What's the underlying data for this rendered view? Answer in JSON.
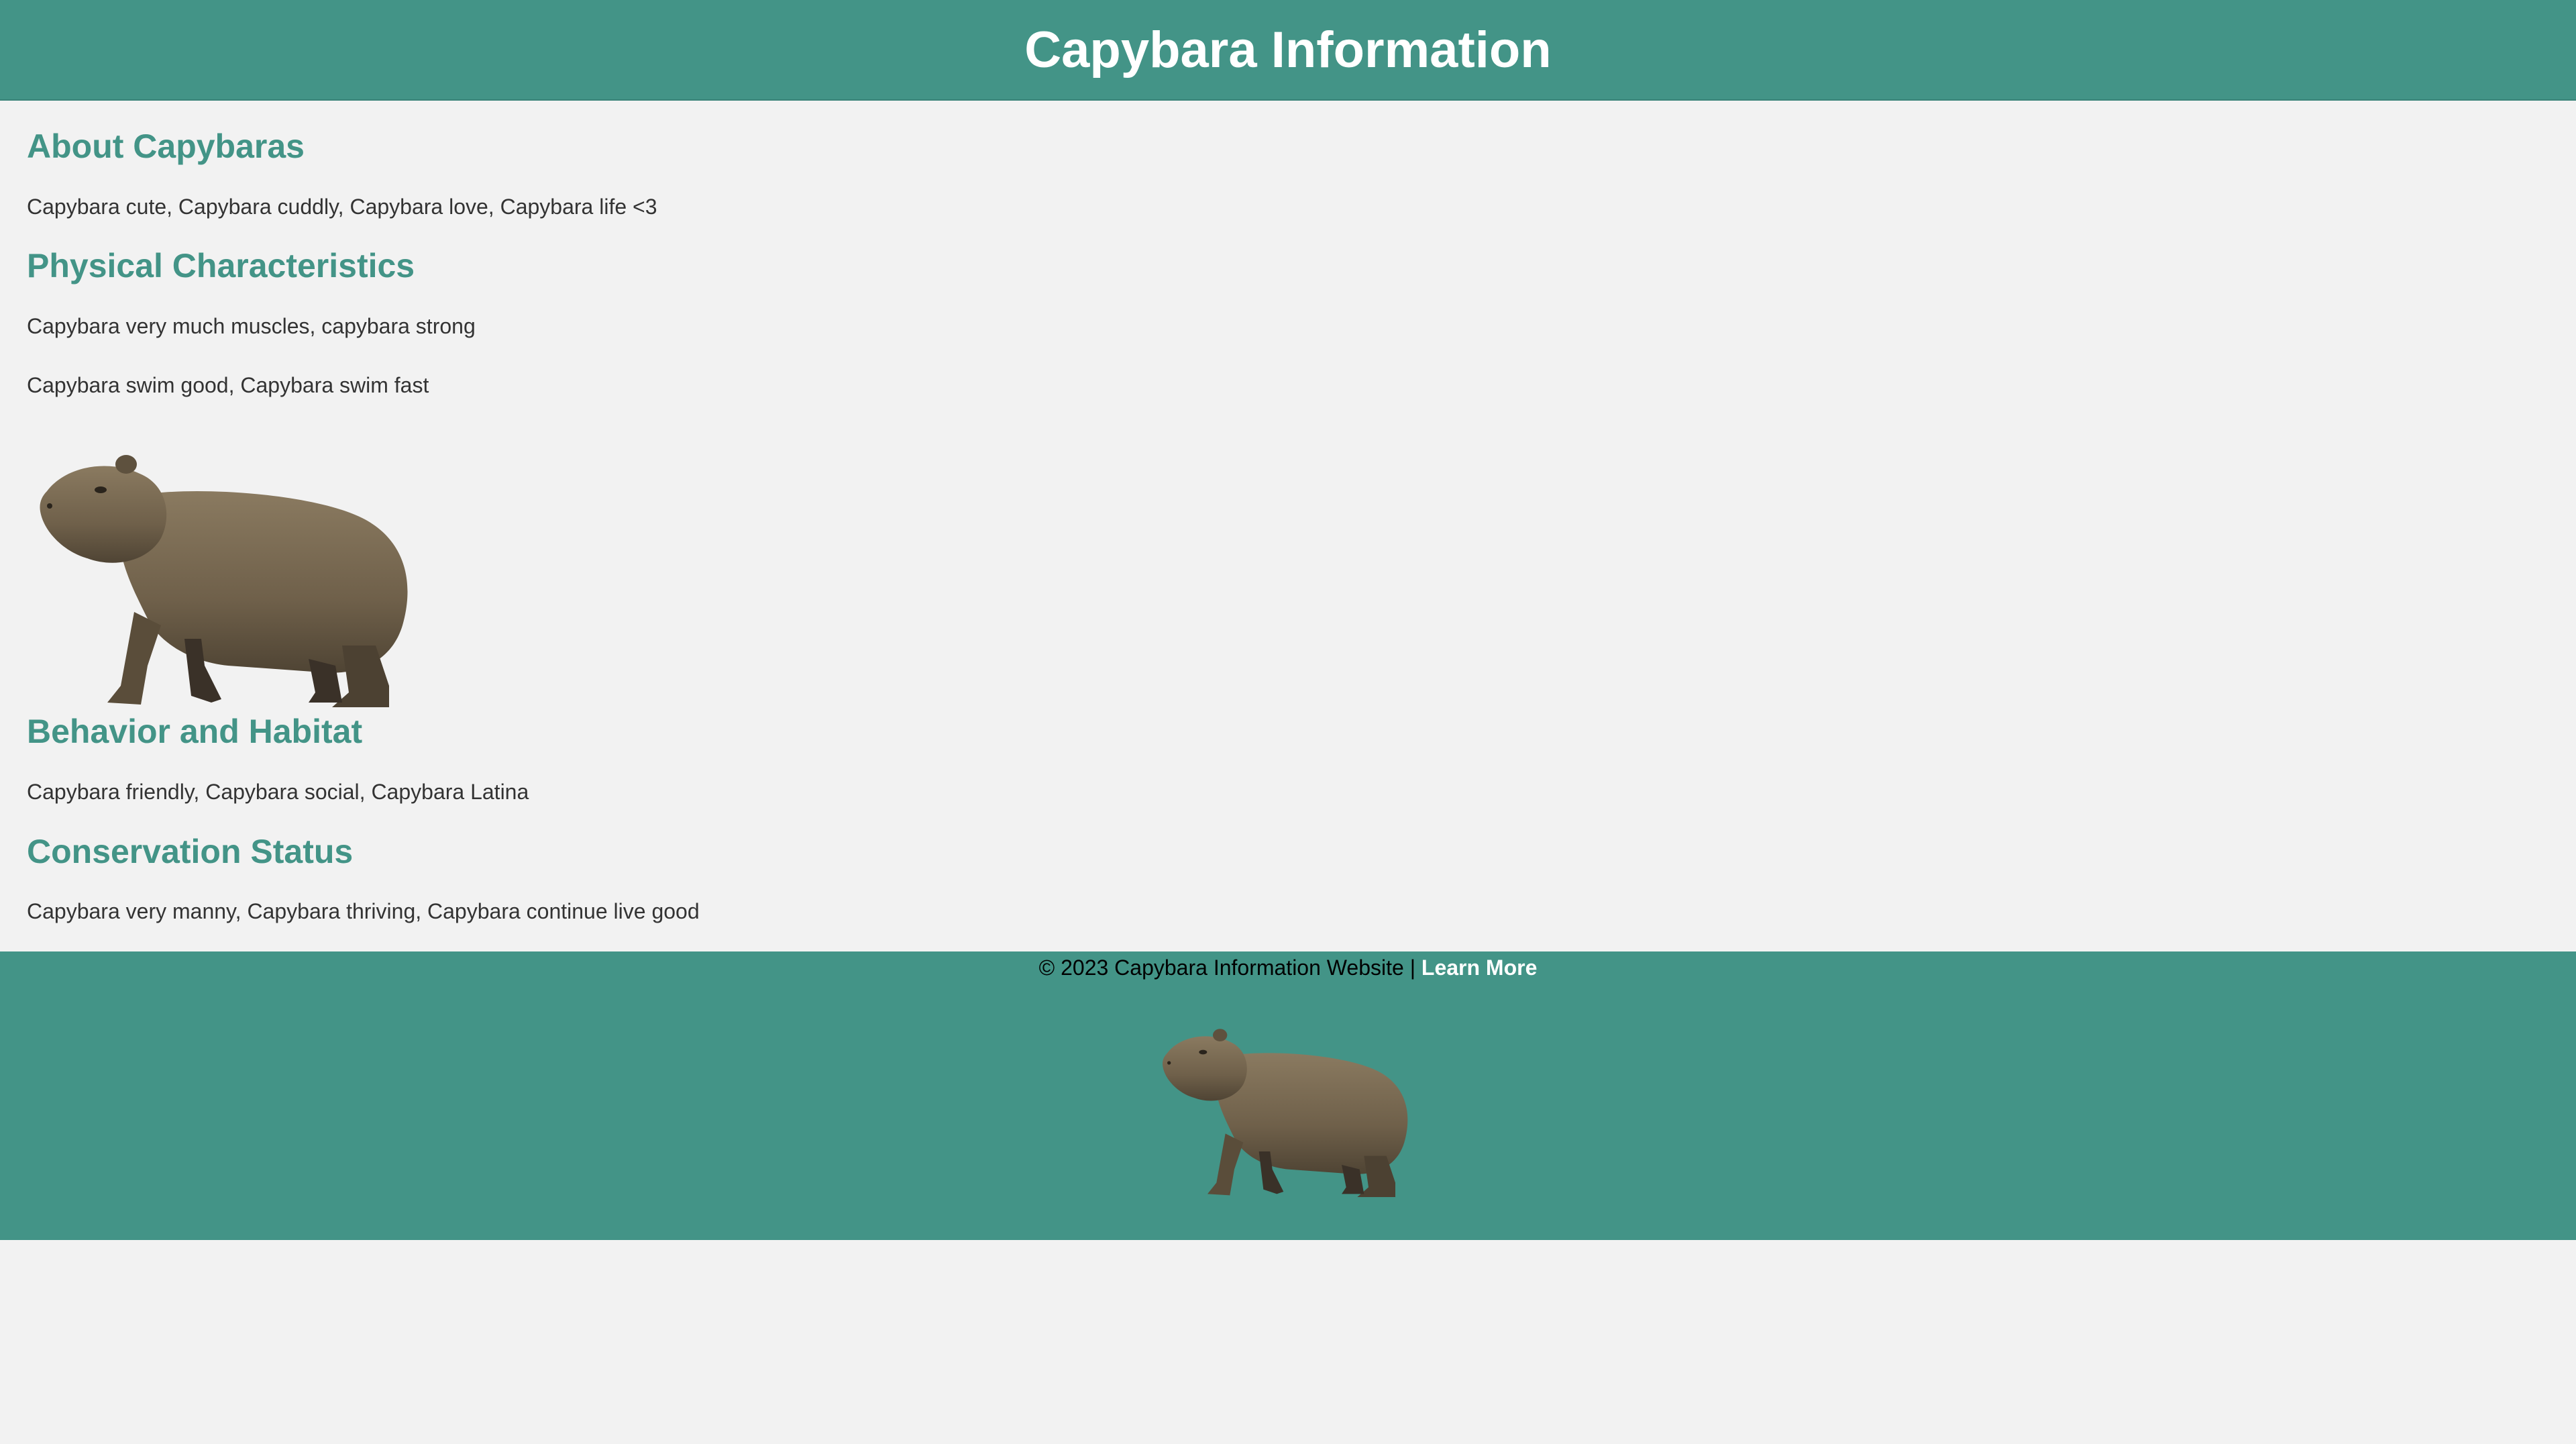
{
  "header": {
    "title": "Capybara Information"
  },
  "sections": {
    "about": {
      "heading": "About Capybaras",
      "text": "Capybara cute, Capybara cuddly, Capybara love, Capybara life <3"
    },
    "physical": {
      "heading": "Physical Characteristics",
      "text_1": "Capybara very much muscles, capybara strong",
      "text_2": "Capybara swim good, Capybara swim fast"
    },
    "behavior": {
      "heading": "Behavior and Habitat",
      "text": "Capybara friendly, Capybara social, Capybara Latina"
    },
    "conservation": {
      "heading": "Conservation Status",
      "text": "Capybara very manny, Capybara thriving, Capybara continue live good"
    }
  },
  "footer": {
    "copyright": "© 2023 Capybara Information Website | ",
    "link_label": "Learn More"
  },
  "colors": {
    "brand_teal": "#439487",
    "background": "#f2f2f2",
    "text": "#333333"
  },
  "images": {
    "main": "capybara-photo",
    "footer": "capybara-photo"
  }
}
